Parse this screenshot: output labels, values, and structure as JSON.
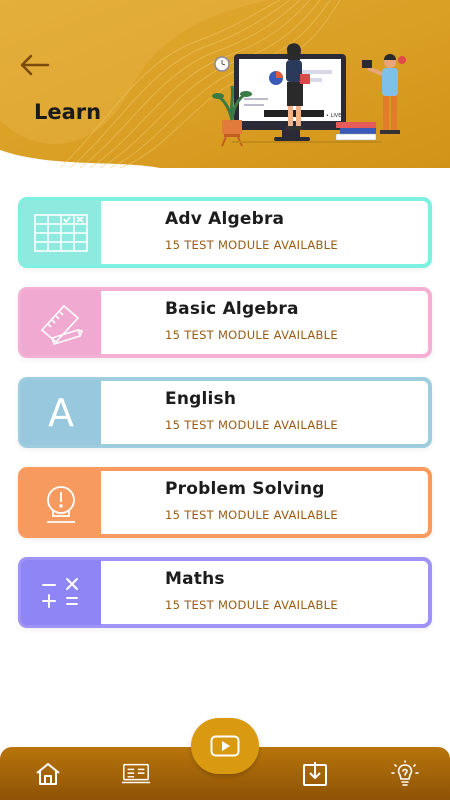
{
  "header": {
    "title": "Learn",
    "back_icon": "arrow-left-icon",
    "bg_color": "#dca329",
    "illustration_live": "• LIVE"
  },
  "modules": [
    {
      "name": "Adv Algebra",
      "subtitle": "15 TEST MODULE AVAILABLE",
      "icon": "spreadsheet-grid-icon",
      "color": "#7ef0df",
      "thumb": "#8ee9df"
    },
    {
      "name": "Basic Algebra",
      "subtitle": "15 TEST MODULE AVAILABLE",
      "icon": "ruler-pencil-icon",
      "color": "#f4b0d4",
      "thumb": "#f0a9d0"
    },
    {
      "name": "English",
      "subtitle": "15 TEST MODULE AVAILABLE",
      "icon": "letter-a-icon",
      "letter": "A",
      "color": "#9fcde0",
      "thumb": "#97c8de"
    },
    {
      "name": "Problem Solving",
      "subtitle": "15 TEST MODULE AVAILABLE",
      "icon": "head-exclamation-icon",
      "color": "#fa9a5e",
      "thumb": "#f79a60"
    },
    {
      "name": "Maths",
      "subtitle": "15 TEST MODULE AVAILABLE",
      "icon": "math-operators-icon",
      "color": "#9f93f7",
      "thumb": "#8f86f5"
    }
  ],
  "bottom_nav": {
    "items": [
      "home-icon",
      "monitor-list-icon",
      "play-video-icon",
      "download-box-icon",
      "lightbulb-icon"
    ],
    "color": "#a96a0b",
    "fab_color": "#d99a12"
  }
}
